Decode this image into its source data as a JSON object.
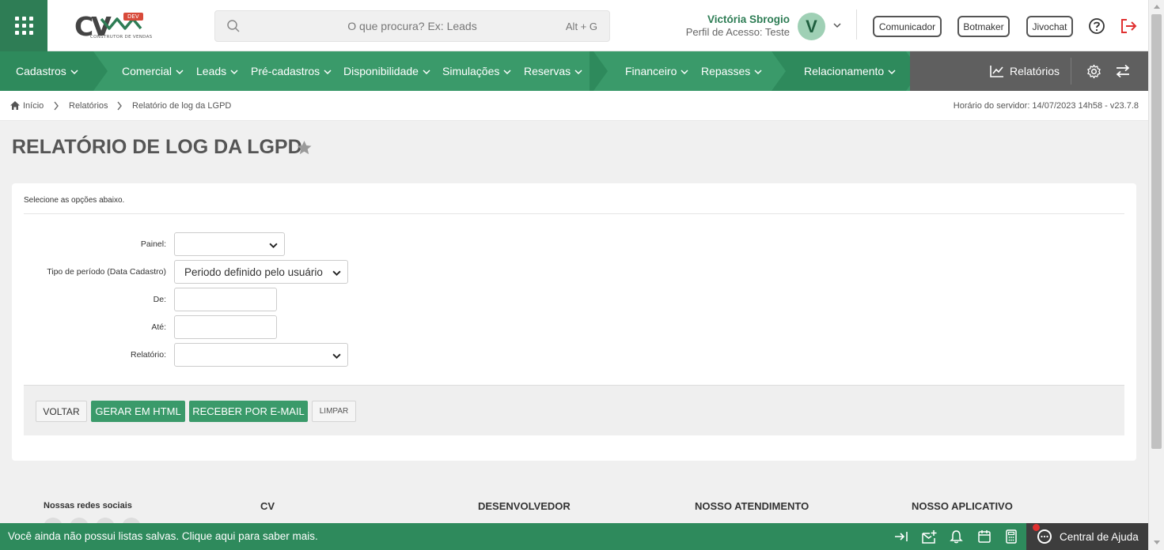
{
  "header": {
    "logo": {
      "text": "CV",
      "badge": "DEV",
      "tagline": "CONSTRUTOR DE VENDAS"
    },
    "search": {
      "placeholder": "O que procura? Ex: Leads",
      "shortcut": "Alt + G"
    },
    "user": {
      "name": "Victória Sbrogio",
      "profile": "Perfil de Acesso: Teste",
      "initial": "V"
    },
    "buttons": [
      "Comunicador",
      "Botmaker",
      "Jivochat"
    ],
    "icons": {
      "apps": "apps-grid-icon",
      "help": "help-circle-icon",
      "logout": "logout-icon"
    }
  },
  "nav": {
    "items": [
      {
        "label": "Cadastros"
      },
      {
        "label": "Comercial"
      },
      {
        "label": "Leads"
      },
      {
        "label": "Pré-cadastros"
      },
      {
        "label": "Disponibilidade"
      },
      {
        "label": "Simulações"
      },
      {
        "label": "Reservas"
      },
      {
        "label": "Financeiro"
      },
      {
        "label": "Repasses"
      },
      {
        "label": "Relacionamento"
      }
    ],
    "reports_label": "Relatórios",
    "colors": {
      "primary": "#3a9a6a",
      "dark": "#2e7d55",
      "grey": "#5f5f5f"
    }
  },
  "breadcrumb": {
    "items": [
      "Início",
      "Relatórios",
      "Relatório de log da LGPD"
    ],
    "server_time": "Horário do servidor: 14/07/2023 14h58 - v23.7.8"
  },
  "page": {
    "title": "RELATÓRIO DE LOG DA LGPD"
  },
  "form": {
    "hint": "Selecione as opções abaixo.",
    "fields": {
      "painel": {
        "label": "Painel:",
        "value": ""
      },
      "tipo_periodo": {
        "label": "Tipo de período (Data Cadastro)",
        "value": "Periodo definido pelo usuário"
      },
      "de": {
        "label": "De:",
        "value": ""
      },
      "ate": {
        "label": "Até:",
        "value": ""
      },
      "relatorio": {
        "label": "Relatório:",
        "value": ""
      }
    },
    "buttons": {
      "voltar": "VOLTAR",
      "gerar_html": "GERAR EM HTML",
      "receber_email": "RECEBER POR E-MAIL",
      "limpar": "LIMPAR"
    }
  },
  "footer": {
    "social_title": "Nossas redes sociais",
    "columns": [
      "CV",
      "DESENVOLVEDOR",
      "NOSSO ATENDIMENTO",
      "NOSSO APLICATIVO"
    ]
  },
  "bottombar": {
    "message": "Você ainda não possui listas salvas. Clique aqui para saber mais.",
    "help_center": "Central de Ajuda"
  }
}
